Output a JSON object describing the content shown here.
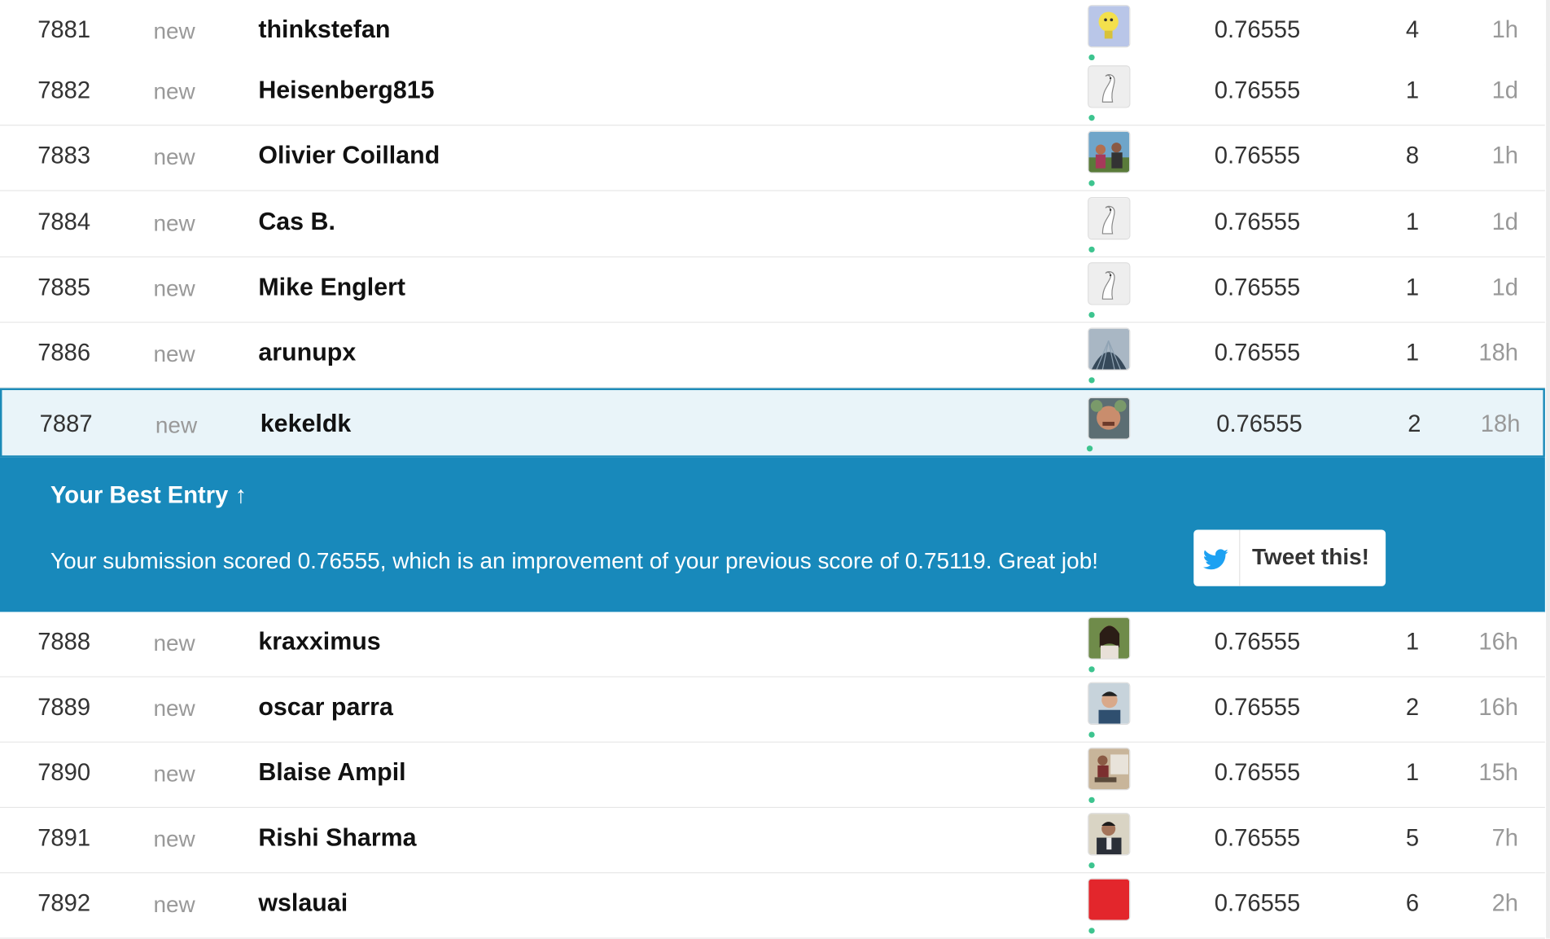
{
  "rows": [
    {
      "rank": "7881",
      "status": "new",
      "name": "thinkstefan",
      "score": "0.76555",
      "entries": "4",
      "last": "1h",
      "avatar": "lightbulb"
    },
    {
      "rank": "7882",
      "status": "new",
      "name": "Heisenberg815",
      "score": "0.76555",
      "entries": "1",
      "last": "1d",
      "avatar": "goose"
    },
    {
      "rank": "7883",
      "status": "new",
      "name": "Olivier Coilland",
      "score": "0.76555",
      "entries": "8",
      "last": "1h",
      "avatar": "photo-people"
    },
    {
      "rank": "7884",
      "status": "new",
      "name": "Cas B.",
      "score": "0.76555",
      "entries": "1",
      "last": "1d",
      "avatar": "goose"
    },
    {
      "rank": "7885",
      "status": "new",
      "name": "Mike Englert",
      "score": "0.76555",
      "entries": "1",
      "last": "1d",
      "avatar": "goose"
    },
    {
      "rank": "7886",
      "status": "new",
      "name": "arunupx",
      "score": "0.76555",
      "entries": "1",
      "last": "18h",
      "avatar": "photo-dome"
    }
  ],
  "me": {
    "rank": "7887",
    "status": "new",
    "name": "kekeldk",
    "score": "0.76555",
    "entries": "2",
    "last": "18h",
    "avatar": "photo-face"
  },
  "banner": {
    "title": "Your Best Entry",
    "arrow": "↑",
    "message": "Your submission scored 0.76555, which is an improvement of your previous score of 0.75119. Great job!",
    "tweet_label": "Tweet this!",
    "twitter_color": "#1da1f2"
  },
  "rows2": [
    {
      "rank": "7888",
      "status": "new",
      "name": "kraxximus",
      "score": "0.76555",
      "entries": "1",
      "last": "16h",
      "avatar": "photo-woman"
    },
    {
      "rank": "7889",
      "status": "new",
      "name": "oscar parra",
      "score": "0.76555",
      "entries": "2",
      "last": "16h",
      "avatar": "photo-man"
    },
    {
      "rank": "7890",
      "status": "new",
      "name": "Blaise Ampil",
      "score": "0.76555",
      "entries": "1",
      "last": "15h",
      "avatar": "photo-sitting"
    },
    {
      "rank": "7891",
      "status": "new",
      "name": "Rishi Sharma",
      "score": "0.76555",
      "entries": "5",
      "last": "7h",
      "avatar": "photo-suit"
    },
    {
      "rank": "7892",
      "status": "new",
      "name": "wslauai",
      "score": "0.76555",
      "entries": "6",
      "last": "2h",
      "avatar": "red-square"
    }
  ],
  "colors": {
    "accent": "#1889bb",
    "online": "#3dc48f"
  }
}
